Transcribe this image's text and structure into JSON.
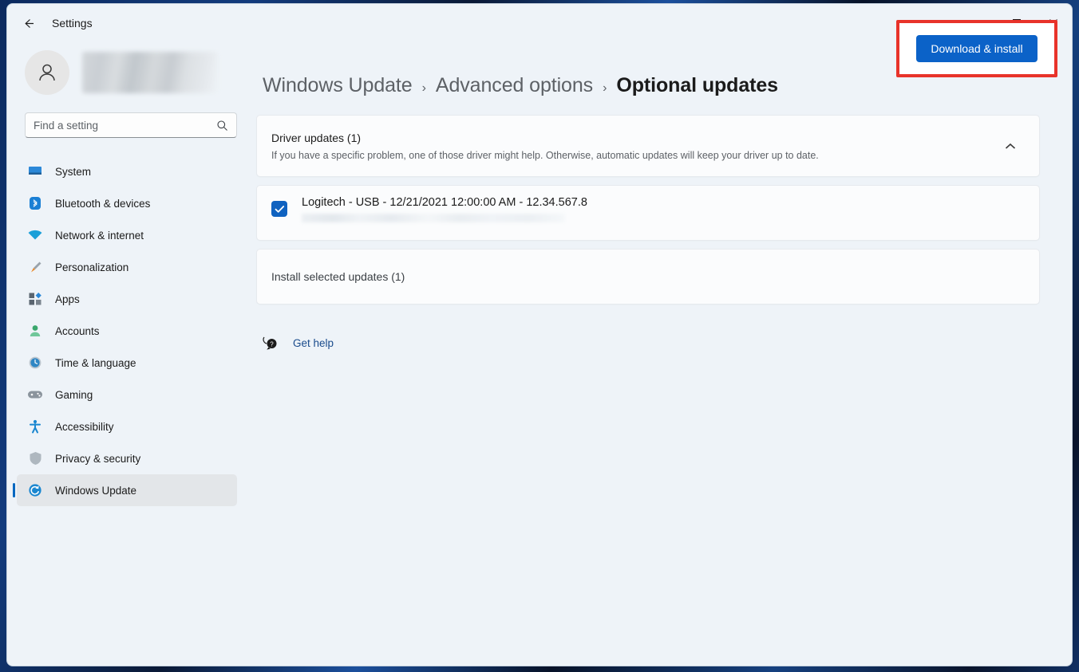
{
  "window": {
    "title": "Settings",
    "back_icon": "arrow-left-icon",
    "controls": {
      "minimize": "—",
      "maximize": "□",
      "close": "✕"
    }
  },
  "sidebar": {
    "avatar_icon": "person-avatar-icon",
    "username_redacted": "",
    "search": {
      "placeholder": "Find a setting",
      "value": "",
      "icon": "search-icon"
    },
    "items": [
      {
        "label": "System",
        "icon": "monitor-icon",
        "selected": false
      },
      {
        "label": "Bluetooth & devices",
        "icon": "bluetooth-icon",
        "selected": false
      },
      {
        "label": "Network & internet",
        "icon": "wifi-icon",
        "selected": false
      },
      {
        "label": "Personalization",
        "icon": "paintbrush-icon",
        "selected": false
      },
      {
        "label": "Apps",
        "icon": "apps-grid-icon",
        "selected": false
      },
      {
        "label": "Accounts",
        "icon": "account-person-icon",
        "selected": false
      },
      {
        "label": "Time & language",
        "icon": "clock-globe-icon",
        "selected": false
      },
      {
        "label": "Gaming",
        "icon": "gamepad-icon",
        "selected": false
      },
      {
        "label": "Accessibility",
        "icon": "accessibility-person-icon",
        "selected": false
      },
      {
        "label": "Privacy & security",
        "icon": "shield-icon",
        "selected": false
      },
      {
        "label": "Windows Update",
        "icon": "windows-update-icon",
        "selected": true
      }
    ]
  },
  "breadcrumb": {
    "separator": "›",
    "items": [
      {
        "label": "Windows Update",
        "current": false
      },
      {
        "label": "Advanced options",
        "current": false
      },
      {
        "label": "Optional updates",
        "current": true
      }
    ]
  },
  "driver_card": {
    "title": "Driver updates (1)",
    "description": "If you have a specific problem, one of those driver might help. Otherwise, automatic updates will keep your driver up to date.",
    "collapse_icon": "chevron-up-icon",
    "expanded": true
  },
  "driver_item": {
    "checked": true,
    "check_icon": "checkmark-icon",
    "title": "Logitech - USB - 12/21/2021 12:00:00 AM - 12.34.567.8",
    "subtitle_redacted": ""
  },
  "install_row": {
    "label": "Install selected updates (1)",
    "button_label": "Download & install",
    "highlighted": true
  },
  "get_help": {
    "label": "Get help",
    "icon": "help-bubble-icon"
  },
  "colors": {
    "accent_blue": "#0b62c8",
    "selected_bar": "#0067c0",
    "annotation_red": "#e8332a",
    "page_bg": "#eef3f8",
    "card_bg": "#fbfcfd",
    "link_blue": "#1a4b8c"
  }
}
